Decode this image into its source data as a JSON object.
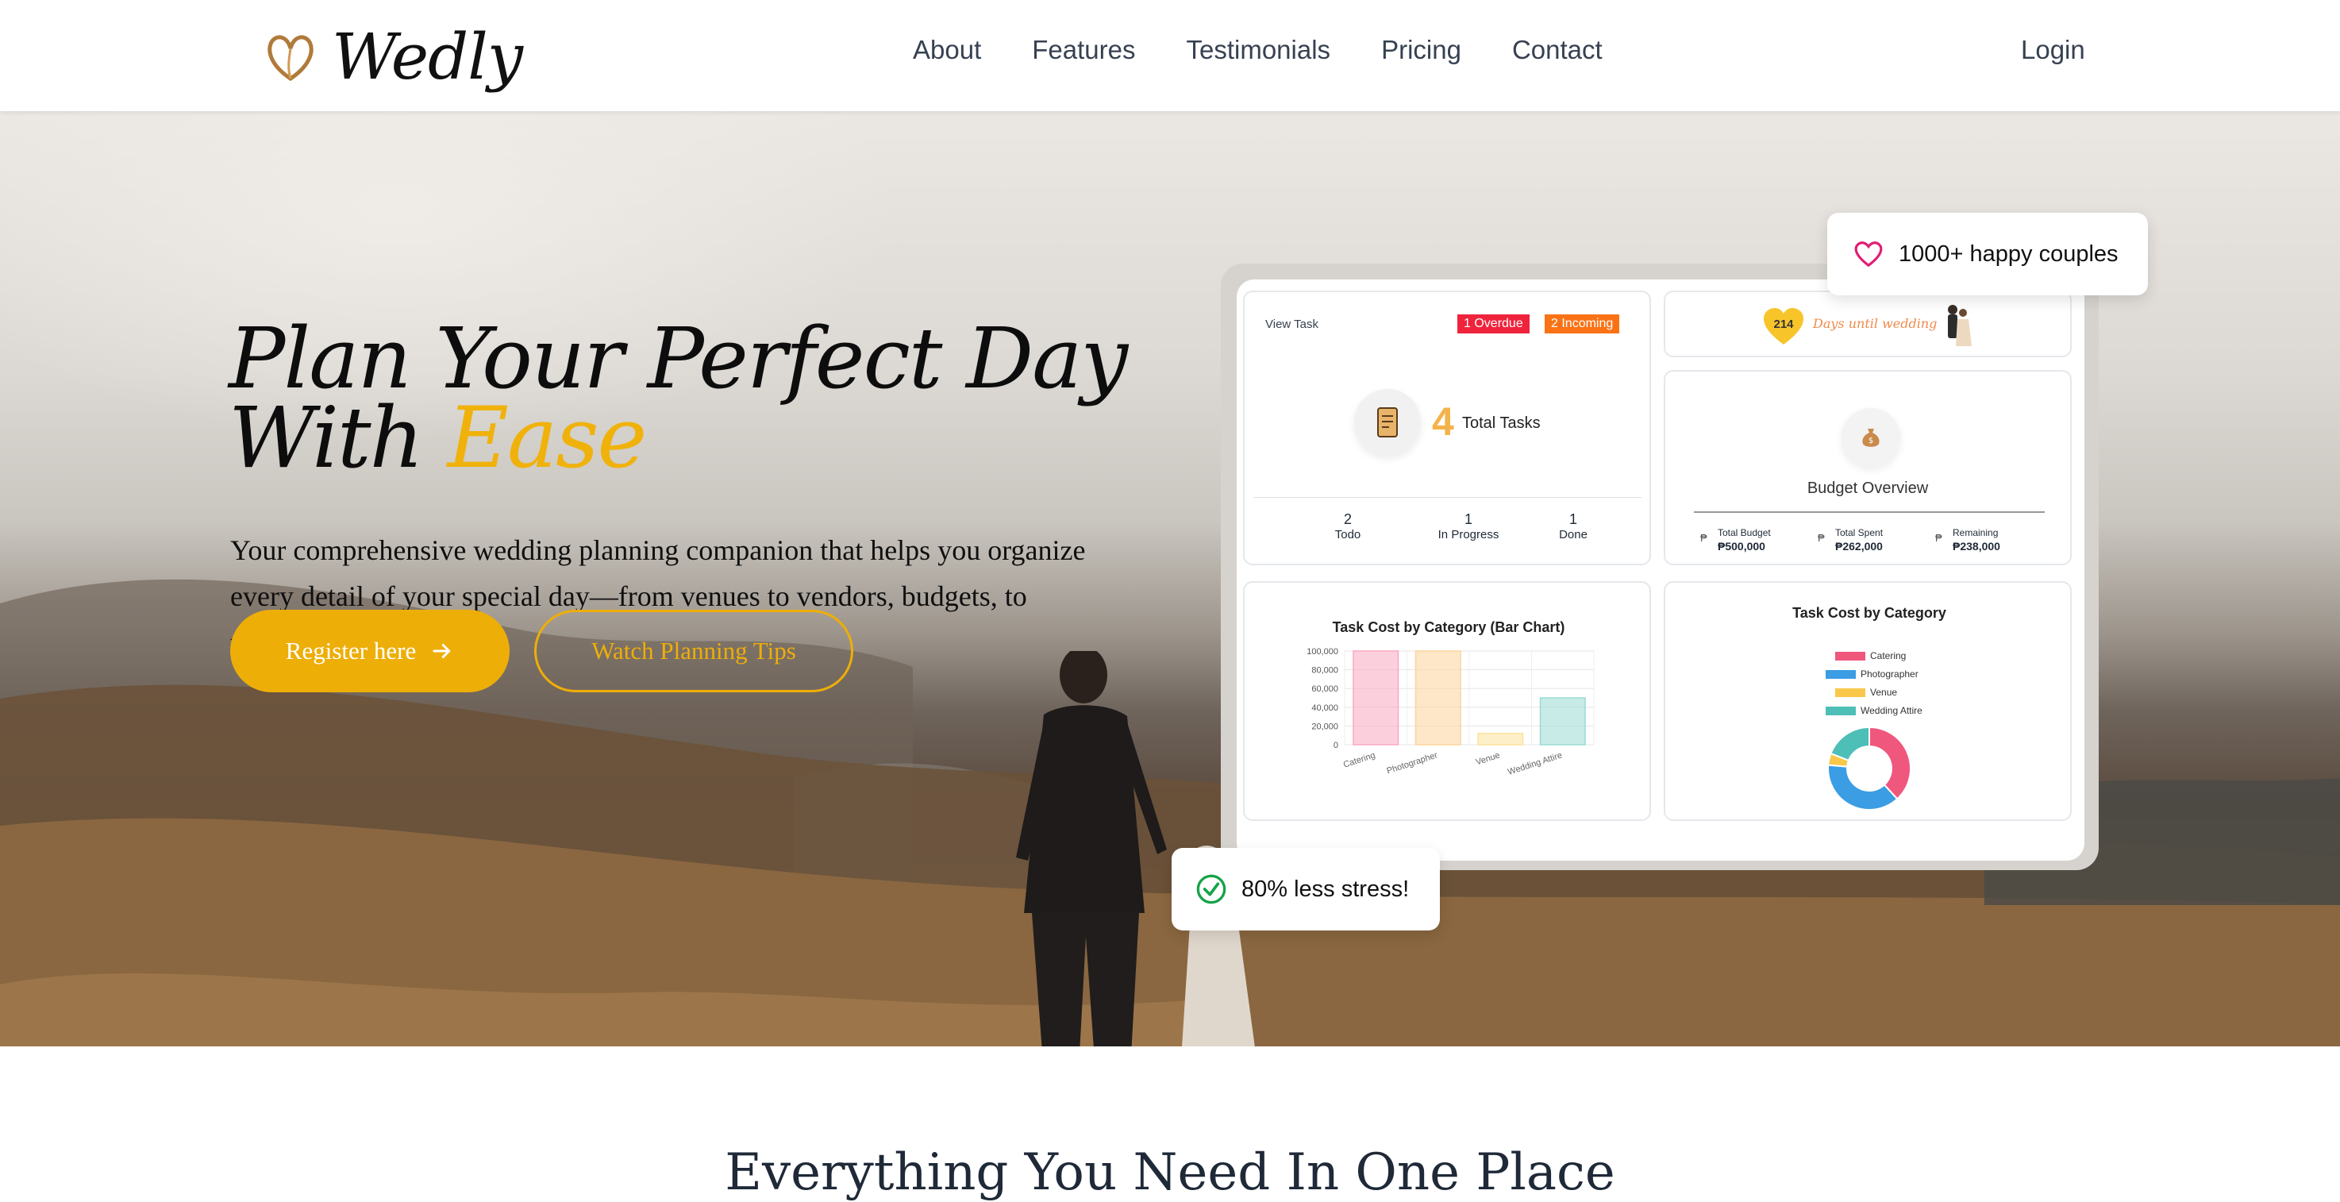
{
  "nav": {
    "brand": "Wedly",
    "links": [
      "About",
      "Features",
      "Testimonials",
      "Pricing",
      "Contact"
    ],
    "login": "Login"
  },
  "hero": {
    "title_line1": "Plan Your Perfect Day",
    "title_line2_prefix": "With ",
    "title_line2_accent": "Ease",
    "description": "Your comprehensive wedding planning companion that helps you organize every detail of your special day—from venues to vendors, budgets, to timelines.",
    "primary_button": "Register here",
    "secondary_button": "Watch Planning Tips"
  },
  "floating": {
    "couples": "1000+ happy couples",
    "stress": "80% less stress!"
  },
  "dashboard": {
    "tasks": {
      "header": "View Task",
      "overdue": "1 Overdue",
      "incoming": "2 Incoming",
      "total_number": "4",
      "total_label": "Total Tasks",
      "stats": [
        {
          "value": "2",
          "label": "Todo"
        },
        {
          "value": "1",
          "label": "In Progress"
        },
        {
          "value": "1",
          "label": "Done"
        }
      ]
    },
    "countdown": {
      "days": "214",
      "label": "Days until wedding"
    },
    "budget": {
      "title": "Budget Overview",
      "items": [
        {
          "label": "Total Budget",
          "value": "₱500,000"
        },
        {
          "label": "Total Spent",
          "value": "₱262,000"
        },
        {
          "label": "Remaining",
          "value": "₱238,000"
        }
      ]
    },
    "pie_title": "Task Cost by Category"
  },
  "chart_data": [
    {
      "type": "bar",
      "title": "Task Cost by Category (Bar Chart)",
      "categories": [
        "Catering",
        "Photographer",
        "Venue",
        "Wedding Attire"
      ],
      "values": [
        100000,
        100000,
        12000,
        50000
      ],
      "y_ticks": [
        "100,000",
        "80,000",
        "60,000",
        "40,000",
        "20,000",
        "0"
      ],
      "ylim": [
        0,
        100000
      ],
      "colors": [
        "#f9a8c0",
        "#fcd39b",
        "#fbe29a",
        "#9adbd4"
      ]
    },
    {
      "type": "pie",
      "title": "Task Cost by Category",
      "categories": [
        "Catering",
        "Photographer",
        "Venue",
        "Wedding Attire"
      ],
      "values": [
        100000,
        100000,
        12000,
        50000
      ],
      "colors": [
        "#f0577d",
        "#3b9de3",
        "#f9c84a",
        "#4dbfb7"
      ]
    }
  ],
  "bottom": {
    "title": "Everything You Need In One Place"
  },
  "colors": {
    "accent": "#eeae08",
    "overdue": "#ef233c",
    "incoming": "#f97316",
    "heart": "#e11d74",
    "check": "#16a34a"
  }
}
